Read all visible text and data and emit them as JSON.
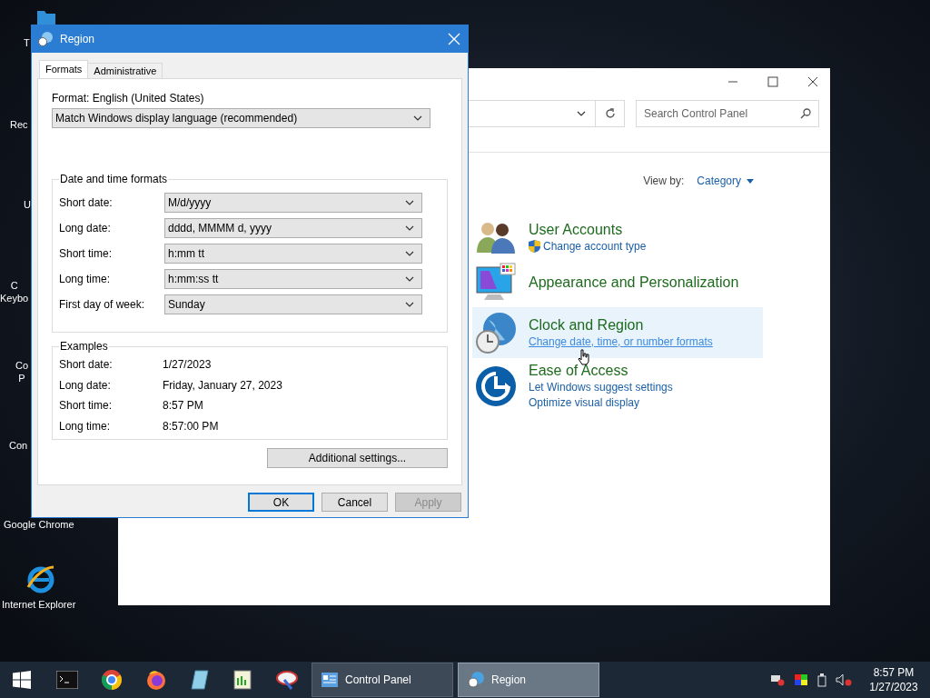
{
  "desktop_icons": [
    {
      "label": "T",
      "kind": "folder"
    },
    {
      "label": "Rec",
      "kind": "none"
    },
    {
      "label": "U",
      "kind": "none"
    },
    {
      "label": "C\nKeybo",
      "kind": "none"
    },
    {
      "label": "Co\nP",
      "kind": "none"
    },
    {
      "label": "Con",
      "kind": "none"
    },
    {
      "label": "Google Chrome",
      "kind": "none"
    },
    {
      "label": "Internet Explorer",
      "kind": "ie"
    }
  ],
  "control_panel": {
    "search": {
      "placeholder": "Search Control Panel"
    },
    "view_by": {
      "label": "View by:",
      "value": "Category"
    },
    "categories": [
      {
        "kind": "users",
        "title": "User Accounts",
        "highlighted": false,
        "links": [
          {
            "text": "Change account type",
            "shield": true,
            "hovered": false
          }
        ]
      },
      {
        "kind": "appearance",
        "title": "Appearance and Personalization",
        "highlighted": false
      },
      {
        "kind": "clock",
        "title": "Clock and Region",
        "highlighted": true,
        "links": [
          {
            "text": "Change date, time, or number formats",
            "shield": false,
            "hovered": true
          }
        ]
      },
      {
        "kind": "access",
        "title": "Ease of Access",
        "highlighted": false,
        "links": [
          {
            "text": "Let Windows suggest settings",
            "shield": false,
            "hovered": false
          },
          {
            "text": "Optimize visual display",
            "shield": false,
            "hovered": false
          }
        ]
      }
    ]
  },
  "dialog": {
    "title": "Region",
    "tabs": [
      {
        "label": "Formats",
        "selected": true
      },
      {
        "label": "Administrative",
        "selected": false
      }
    ],
    "format_label": "Format: English (United States)",
    "format_value": "Match Windows display language (recommended)",
    "formats_group": {
      "title": "Date and time formats",
      "rows": [
        {
          "label": "Short date:",
          "value": "M/d/yyyy"
        },
        {
          "label": "Long date:",
          "value": "dddd, MMMM d, yyyy"
        },
        {
          "label": "Short time:",
          "value": "h:mm tt"
        },
        {
          "label": "Long time:",
          "value": "h:mm:ss tt"
        },
        {
          "label": "First day of week:",
          "value": "Sunday"
        }
      ]
    },
    "examples_group": {
      "title": "Examples",
      "rows": [
        {
          "label": "Short date:",
          "value": "1/27/2023"
        },
        {
          "label": "Long date:",
          "value": "Friday, January 27, 2023"
        },
        {
          "label": "Short time:",
          "value": "8:57 PM"
        },
        {
          "label": "Long time:",
          "value": "8:57:00 PM"
        }
      ]
    },
    "additional_button": "Additional settings...",
    "buttons": [
      {
        "label": "OK",
        "default": true,
        "disabled": false
      },
      {
        "label": "Cancel",
        "default": false,
        "disabled": false
      },
      {
        "label": "Apply",
        "default": false,
        "disabled": true
      }
    ]
  },
  "taskbar": {
    "windows": [
      {
        "label": "Control Panel",
        "selected": false,
        "kind": "cp"
      },
      {
        "label": "Region",
        "selected": true,
        "kind": "region"
      }
    ],
    "time": "8:57 PM",
    "date": "1/27/2023"
  }
}
